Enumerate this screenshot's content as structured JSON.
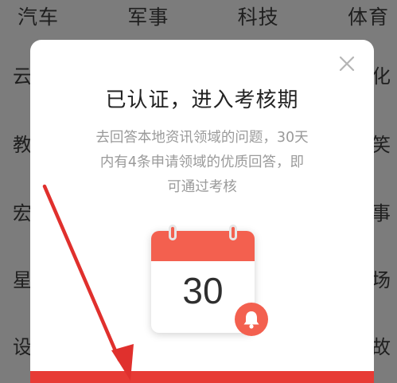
{
  "background": {
    "top_tabs": [
      "汽车",
      "军事",
      "科技",
      "体育"
    ],
    "left_edge_chars": [
      "云",
      "教",
      "宏",
      "星",
      "设"
    ],
    "right_edge_chars": [
      "化",
      "笑",
      "事",
      "场",
      "故"
    ]
  },
  "modal": {
    "title": "已认证，进入考核期",
    "description_lines": [
      "去回答本地资讯领域的问题，30天",
      "内有4条申请领域的优质回答，即",
      "可通过考核"
    ],
    "calendar_number": "30",
    "close_icon": "close-icon",
    "bell_icon": "bell-icon"
  },
  "colors": {
    "accent": "#f3604f",
    "bottom_bar": "#e73b35",
    "arrow": "#e0302d",
    "overlay": "#7c7c7c"
  }
}
